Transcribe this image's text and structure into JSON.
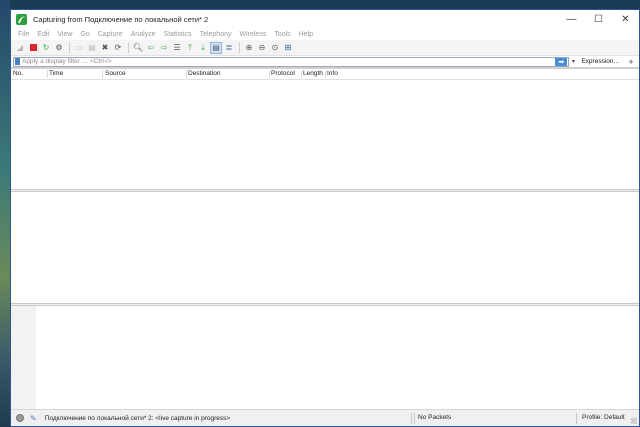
{
  "window": {
    "title": "Capturing from Подключение по локальной сети* 2",
    "controls": {
      "minimize": "—",
      "maximize": "☐",
      "close": "✕"
    }
  },
  "menubar": {
    "items": [
      {
        "label": "File"
      },
      {
        "label": "Edit"
      },
      {
        "label": "View"
      },
      {
        "label": "Go"
      },
      {
        "label": "Capture"
      },
      {
        "label": "Analyze"
      },
      {
        "label": "Statistics"
      },
      {
        "label": "Telephony"
      },
      {
        "label": "Wireless"
      },
      {
        "label": "Tools"
      },
      {
        "label": "Help"
      }
    ]
  },
  "filter": {
    "placeholder": "Apply a display filter … <Ctrl-/>",
    "apply_glyph": "➡",
    "dropdown_glyph": "▾",
    "expression_label": "Expression…",
    "add_glyph": "+"
  },
  "packet_list": {
    "columns": [
      "No.",
      "Time",
      "Source",
      "Destination",
      "Protocol",
      "Length",
      "Info"
    ]
  },
  "statusbar": {
    "interface_text": "Подключение по локальной сети* 2: <live capture in progress>",
    "packets_text": "No Packets",
    "profile_text": "Profile: Default"
  },
  "colors": {
    "accent": "#4a8fd6",
    "stop_red": "#d9262c",
    "restart_green": "#3aa84a"
  }
}
